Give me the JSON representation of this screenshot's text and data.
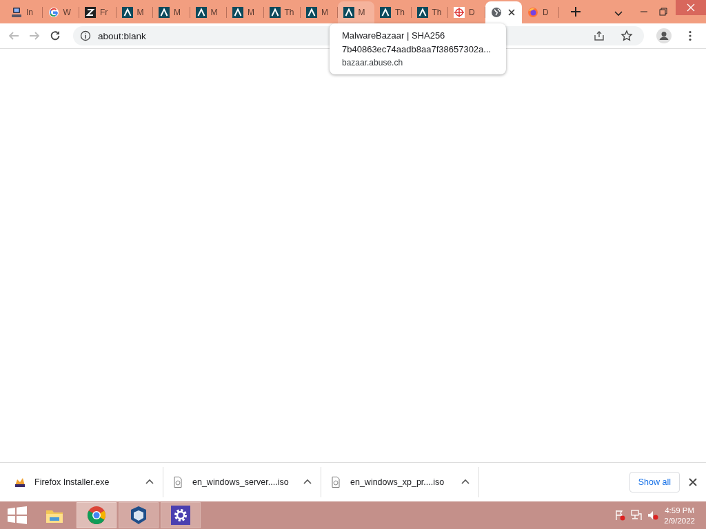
{
  "tabs": [
    {
      "kind": "computer",
      "title": "In",
      "selected": false,
      "hovered": false
    },
    {
      "kind": "google",
      "title": "W",
      "selected": false,
      "hovered": false
    },
    {
      "kind": "z",
      "title": "Fr",
      "selected": false,
      "hovered": false
    },
    {
      "kind": "lambda",
      "title": "M",
      "selected": false,
      "hovered": false
    },
    {
      "kind": "lambda",
      "title": "M",
      "selected": false,
      "hovered": false
    },
    {
      "kind": "lambda",
      "title": "M",
      "selected": false,
      "hovered": false
    },
    {
      "kind": "lambda",
      "title": "M",
      "selected": false,
      "hovered": false
    },
    {
      "kind": "lambda",
      "title": "Th",
      "selected": false,
      "hovered": false
    },
    {
      "kind": "lambda",
      "title": "M",
      "selected": false,
      "hovered": false
    },
    {
      "kind": "lambda",
      "title": "M",
      "selected": false,
      "hovered": true
    },
    {
      "kind": "lambda",
      "title": "Th",
      "selected": false,
      "hovered": false
    },
    {
      "kind": "lambda",
      "title": "Th",
      "selected": false,
      "hovered": false
    },
    {
      "kind": "target",
      "title": "D",
      "selected": false,
      "hovered": false
    },
    {
      "kind": "globe",
      "selected": true,
      "hovered": false
    },
    {
      "kind": "firefox",
      "title": "D",
      "selected": false,
      "hovered": false
    }
  ],
  "toolbar": {
    "address": "about:blank"
  },
  "tooltip": {
    "title": "MalwareBazaar | SHA256",
    "subtitle": "7b40863ec74aadb8aa7f38657302a...",
    "url": "bazaar.abuse.ch"
  },
  "downloads": {
    "items": [
      {
        "kind": "firefox",
        "name": "Firefox Installer.exe"
      },
      {
        "kind": "file",
        "name": "en_windows_server....iso"
      },
      {
        "kind": "file",
        "name": "en_windows_xp_pr....iso"
      }
    ],
    "show_all": "Show all"
  },
  "taskbar": {
    "apps": [
      {
        "kind": "folder",
        "running": false,
        "selected": false
      },
      {
        "kind": "chrome",
        "running": true,
        "selected": true
      },
      {
        "kind": "cube",
        "running": true,
        "selected": false
      },
      {
        "kind": "gear",
        "running": true,
        "selected": false
      }
    ],
    "time": "4:59 PM",
    "date": "2/9/2022"
  }
}
